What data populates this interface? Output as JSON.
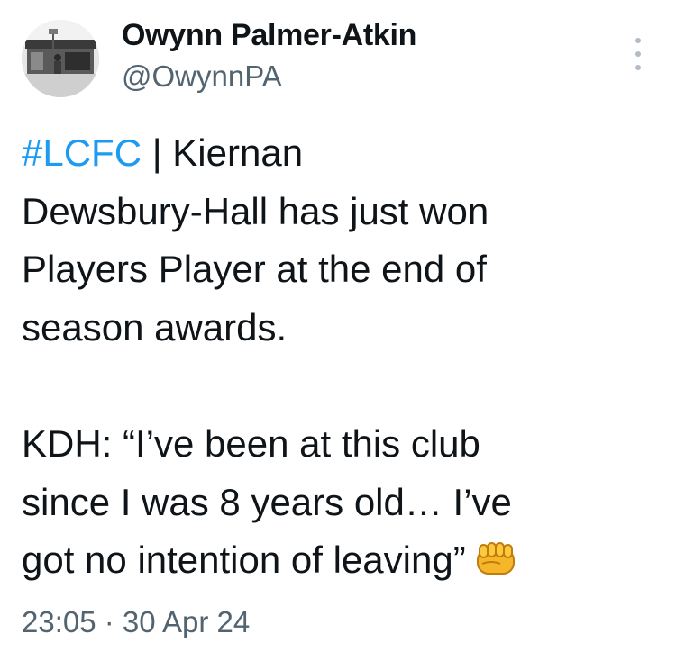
{
  "author": {
    "name": "Owynn Palmer-Atkin",
    "handle": "@OwynnPA"
  },
  "tweet": {
    "hashtag": "#LCFC",
    "line1_rest": " | Kiernan",
    "line2": "Dewsbury-Hall has just won",
    "line3": "Players Player at the end of",
    "line4": "season awards.",
    "line5": "KDH: “I’ve been at this club",
    "line6": "since I was 8 years old… I’ve",
    "line7": "got no intention of leaving”",
    "emoji": "oncoming-fist-emoji"
  },
  "meta": {
    "time": "23:05",
    "separator": " · ",
    "date": "30 Apr 24"
  },
  "colors": {
    "hashtag": "#1d9bf0",
    "secondary": "#536471",
    "text": "#0f1419"
  }
}
